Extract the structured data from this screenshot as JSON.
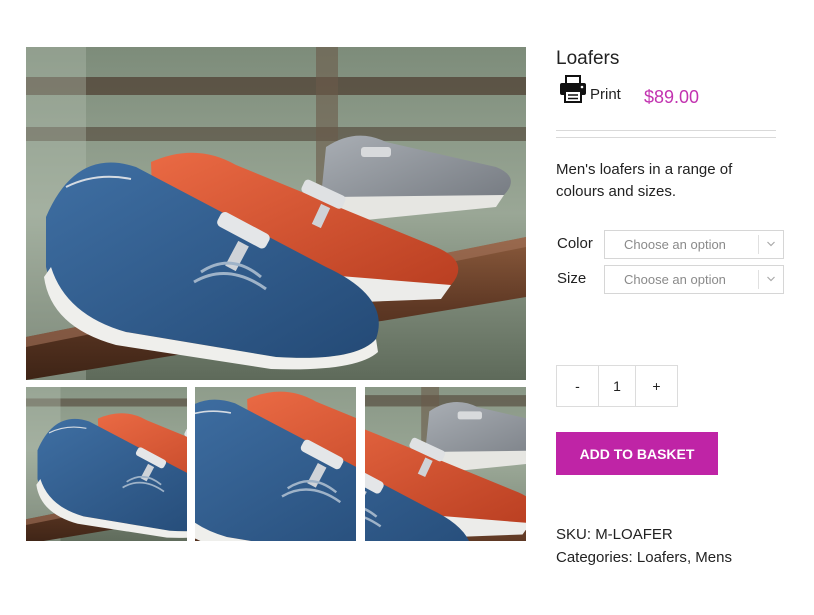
{
  "product": {
    "title": "Loafers",
    "print_label": "Print",
    "price": "$89.00",
    "description": "Men's loafers in a range of colours and sizes.",
    "variations": {
      "color_label": "Color",
      "color_placeholder": "Choose an option",
      "size_label": "Size",
      "size_placeholder": "Choose an option"
    },
    "quantity": {
      "minus_label": "-",
      "value": "1",
      "plus_label": "+"
    },
    "add_to_basket_label": "ADD TO BASKET",
    "sku_label": "SKU:",
    "sku_value": "M-LOAFER",
    "categories_label": "Categories:",
    "category_1": "Loafers",
    "category_sep": ",",
    "category_2": "Mens"
  },
  "icons": {
    "print": "printer-icon",
    "select_arrow": "chevron-down-icon"
  },
  "colors": {
    "accent": "#bf24a6",
    "price": "#c233b0",
    "shoe_blue": "#2f5d8e",
    "shoe_orange": "#d9502e",
    "shoe_grey": "#8a8f96"
  }
}
